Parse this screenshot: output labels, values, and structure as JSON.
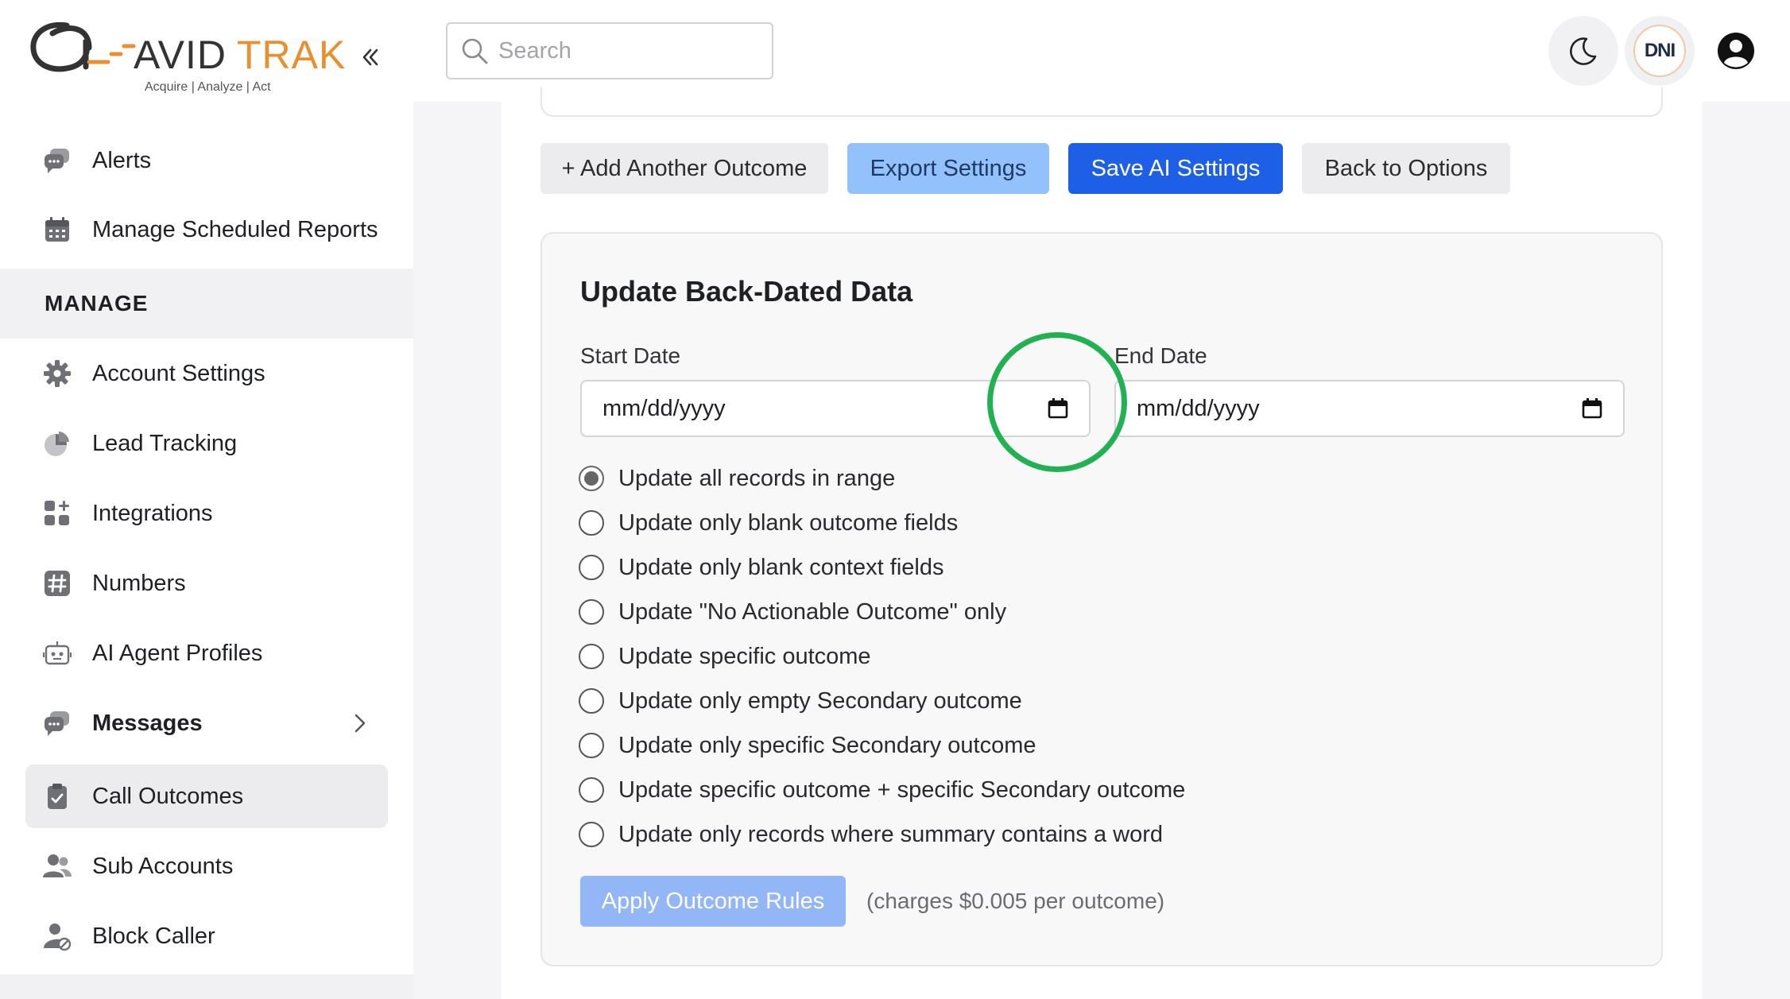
{
  "brand": {
    "name": "AVIDTRAK",
    "tagline": [
      "Acquire",
      "Analyze",
      "Act"
    ]
  },
  "sidebar": {
    "items_top": [
      {
        "label": "Alerts",
        "icon": "chat-bubbles-icon"
      },
      {
        "label": "Manage Scheduled Reports",
        "icon": "calendar-icon"
      }
    ],
    "section_header": "MANAGE",
    "items": [
      {
        "label": "Account Settings",
        "icon": "gear-icon"
      },
      {
        "label": "Lead Tracking",
        "icon": "pie-chart-icon"
      },
      {
        "label": "Integrations",
        "icon": "grid-plus-icon"
      },
      {
        "label": "Numbers",
        "icon": "hashtag-icon"
      },
      {
        "label": "AI Agent Profiles",
        "icon": "robot-icon"
      },
      {
        "label": "Messages",
        "icon": "chat-bubbles-icon"
      },
      {
        "label": "Call Outcomes",
        "icon": "clipboard-check-icon"
      },
      {
        "label": "Sub Accounts",
        "icon": "users-icon"
      },
      {
        "label": "Block Caller",
        "icon": "user-block-icon"
      }
    ],
    "active_item": "Call Outcomes"
  },
  "topbar": {
    "search_placeholder": "Search",
    "dni_label": "DNI"
  },
  "actions": {
    "add_outcome": "+ Add Another Outcome",
    "export_settings": "Export Settings",
    "save_ai_settings": "Save AI Settings",
    "back_to_options": "Back to Options"
  },
  "backdated": {
    "title": "Update Back-Dated Data",
    "start_label": "Start Date",
    "end_label": "End Date",
    "start_value": "mm/dd/yyyy",
    "end_value": "mm/dd/yyyy",
    "options": [
      "Update all records in range",
      "Update only blank outcome fields",
      "Update only blank context fields",
      "Update \"No Actionable Outcome\" only",
      "Update specific outcome",
      "Update only empty Secondary outcome",
      "Update only specific Secondary outcome",
      "Update specific outcome + specific Secondary outcome",
      "Update only records where summary contains a word"
    ],
    "selected_option": "Update all records in range",
    "apply_button": "Apply Outcome Rules",
    "charge_note": "(charges $0.005 per outcome)"
  },
  "colors": {
    "primary": "#1d5fe6",
    "primary_light": "#93c1fb",
    "apply_disabled": "#93b6f6",
    "brand_orange": "#e8902f",
    "highlight": "#21b152"
  }
}
